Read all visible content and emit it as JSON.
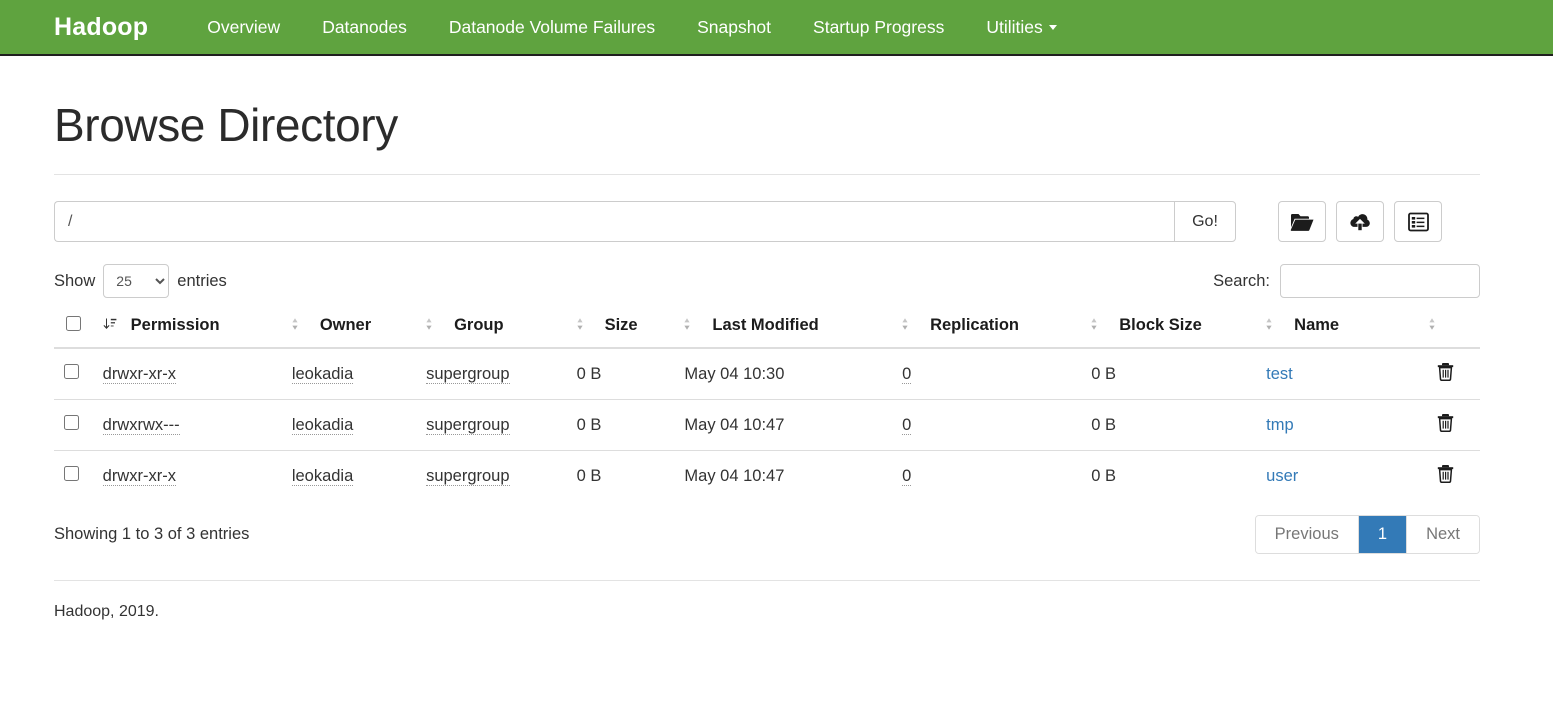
{
  "navbar": {
    "brand": "Hadoop",
    "items": [
      {
        "label": "Overview",
        "icon": ""
      },
      {
        "label": "Datanodes",
        "icon": ""
      },
      {
        "label": "Datanode Volume Failures",
        "icon": ""
      },
      {
        "label": "Snapshot",
        "icon": ""
      },
      {
        "label": "Startup Progress",
        "icon": ""
      },
      {
        "label": "Utilities",
        "icon": "caret-down-icon",
        "dropdown": true
      }
    ],
    "background_color": "#5fa33f",
    "text_color": "#ffffff"
  },
  "page": {
    "title": "Browse Directory"
  },
  "path_bar": {
    "value": "/",
    "placeholder": "",
    "go_label": "Go!",
    "buttons": [
      {
        "name": "create-directory-button",
        "icon": "folder-open-icon"
      },
      {
        "name": "upload-files-button",
        "icon": "cloud-upload-icon"
      },
      {
        "name": "cut-high-availability-button",
        "icon": "list-alt-icon"
      }
    ]
  },
  "tools": {
    "show_label": "Show",
    "entries_label": "entries",
    "page_length_value": "25",
    "page_length_options": [
      "25",
      "50",
      "100"
    ],
    "search_label": "Search:",
    "search_value": "",
    "search_placeholder": ""
  },
  "table": {
    "columns": [
      {
        "label": "",
        "name": "select-all",
        "sort": "sort-amount-icon"
      },
      {
        "label": "Permission",
        "name": "permission",
        "sort": "sort-icon"
      },
      {
        "label": "Owner",
        "name": "owner",
        "sort": "sort-icon"
      },
      {
        "label": "Group",
        "name": "group",
        "sort": "sort-icon"
      },
      {
        "label": "Size",
        "name": "size",
        "sort": "sort-icon"
      },
      {
        "label": "Last Modified",
        "name": "last-modified",
        "sort": "sort-icon"
      },
      {
        "label": "Replication",
        "name": "replication",
        "sort": "sort-icon"
      },
      {
        "label": "Block Size",
        "name": "block-size",
        "sort": "sort-icon"
      },
      {
        "label": "Name",
        "name": "name",
        "sort": "sort-icon"
      }
    ],
    "rows": [
      {
        "permission": "drwxr-xr-x",
        "owner": "leokadia",
        "group": "supergroup",
        "size": "0 B",
        "last_modified": "May 04 10:30",
        "replication": "0",
        "block_size": "0 B",
        "name": "test"
      },
      {
        "permission": "drwxrwx---",
        "owner": "leokadia",
        "group": "supergroup",
        "size": "0 B",
        "last_modified": "May 04 10:47",
        "replication": "0",
        "block_size": "0 B",
        "name": "tmp"
      },
      {
        "permission": "drwxr-xr-x",
        "owner": "leokadia",
        "group": "supergroup",
        "size": "0 B",
        "last_modified": "May 04 10:47",
        "replication": "0",
        "block_size": "0 B",
        "name": "user"
      }
    ]
  },
  "table_footer": {
    "info": "Showing 1 to 3 of 3 entries",
    "previous_label": "Previous",
    "page_1_label": "1",
    "next_label": "Next",
    "active_page_color": "#337ab7"
  },
  "footer": {
    "text": "Hadoop, 2019."
  }
}
